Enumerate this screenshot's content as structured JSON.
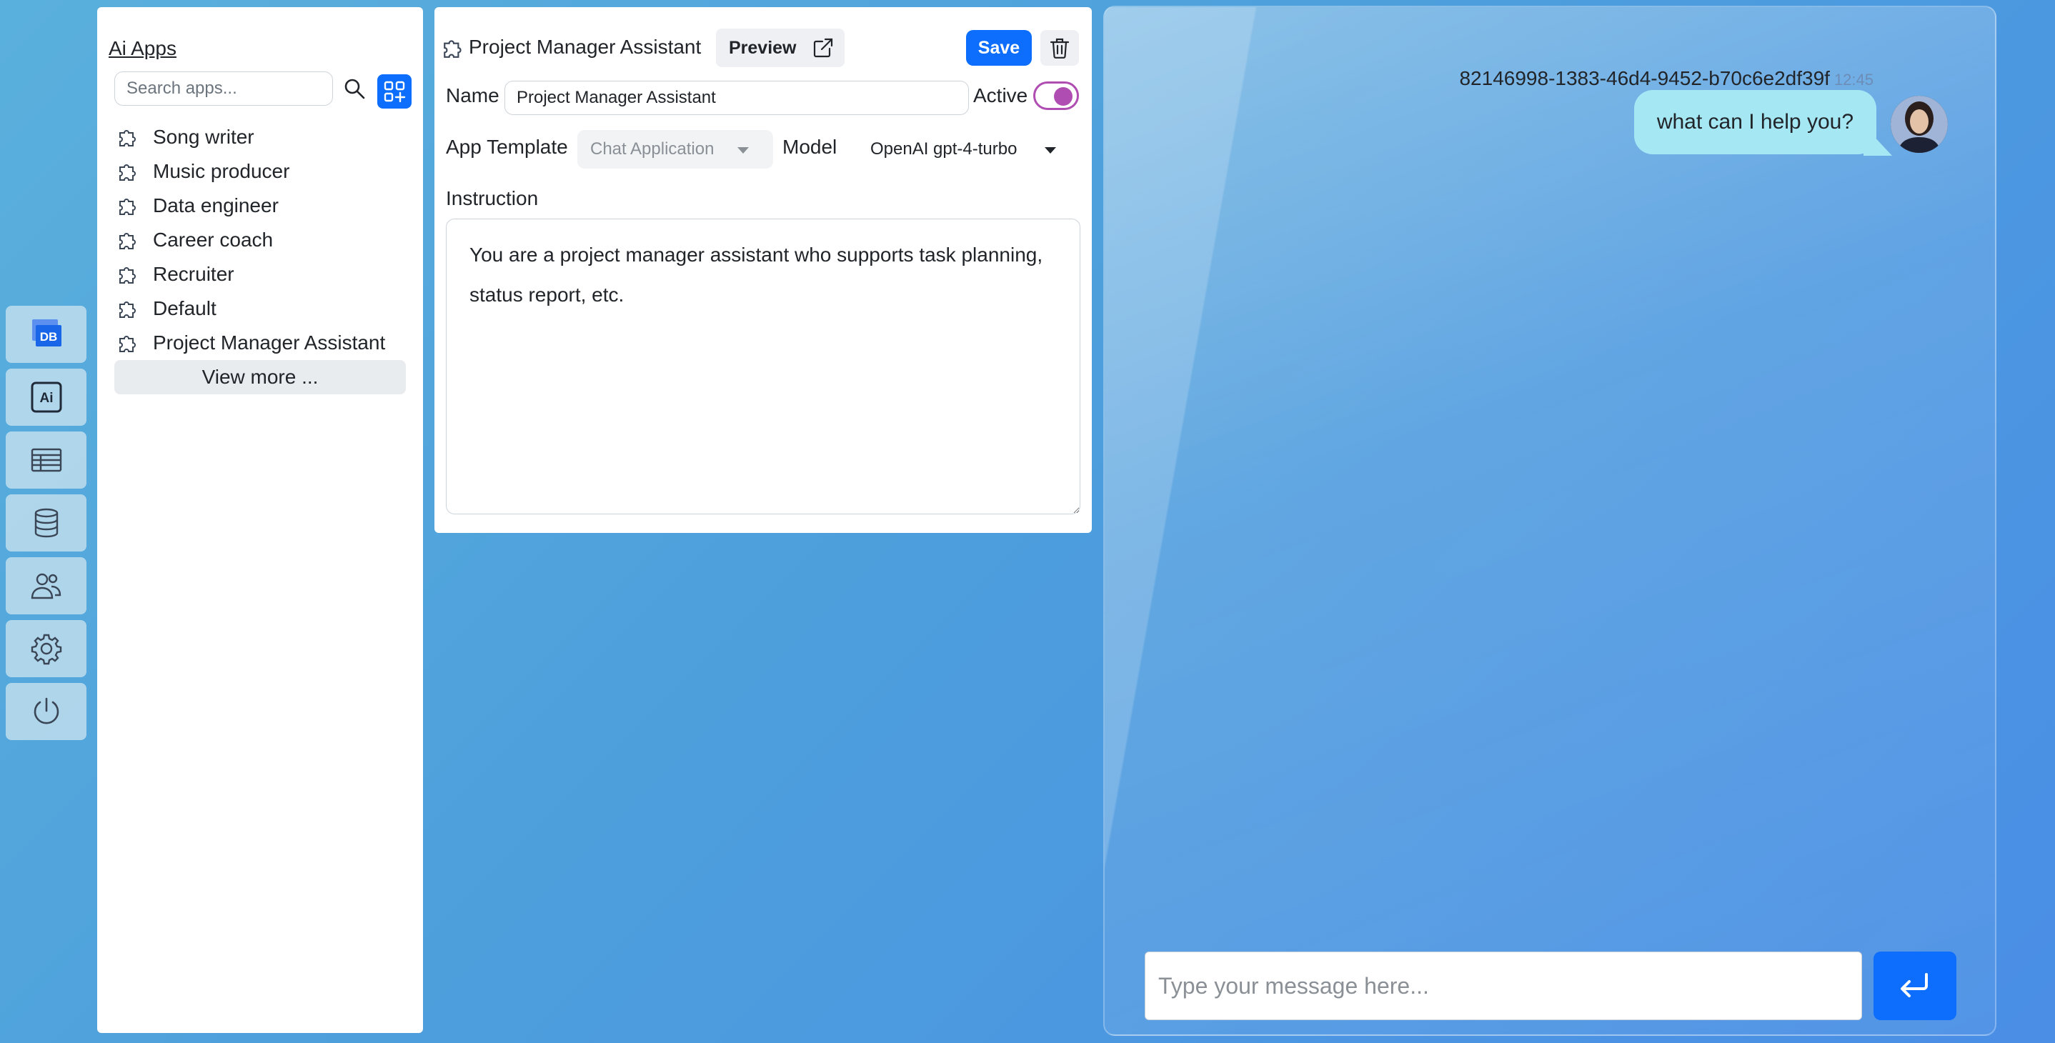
{
  "nav": {
    "items": [
      {
        "name": "db-icon",
        "label": "DB"
      },
      {
        "name": "ai-icon",
        "label": "Ai"
      },
      {
        "name": "table-icon"
      },
      {
        "name": "database-icon"
      },
      {
        "name": "users-icon"
      },
      {
        "name": "gear-icon"
      },
      {
        "name": "power-icon"
      }
    ]
  },
  "apps": {
    "title": "Ai Apps",
    "search_placeholder": "Search apps...",
    "items": [
      "Song writer",
      "Music producer",
      "Data engineer",
      "Career coach",
      "Recruiter",
      "Default",
      "Project Manager Assistant"
    ],
    "view_more": "View more ..."
  },
  "editor": {
    "title": "Project Manager Assistant",
    "preview_label": "Preview",
    "save_label": "Save",
    "name_label": "Name",
    "name_value": "Project Manager Assistant",
    "active_label": "Active",
    "active": true,
    "template_label": "App Template",
    "template_value": "Chat Application",
    "model_label": "Model",
    "model_value": "OpenAI gpt-4-turbo",
    "instruction_label": "Instruction",
    "instruction_value": "You are a project manager assistant who supports task planning, status report, etc."
  },
  "chat": {
    "sender": "82146998-1383-46d4-9452-b70c6e2df39f",
    "time": "12:45",
    "message": "what can I help you?",
    "input_placeholder": "Type your message here..."
  },
  "colors": {
    "primary": "#0d6efd",
    "toggle": "#b04db2",
    "bubble": "#a6e7f4"
  }
}
